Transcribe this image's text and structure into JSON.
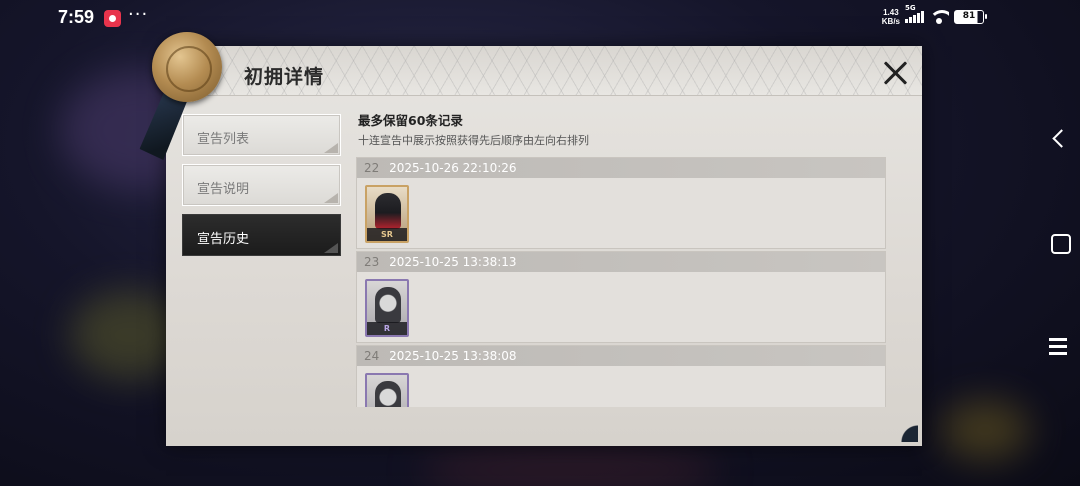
{
  "status_bar": {
    "time": "7:59",
    "dots": "···",
    "net_speed_value": "1.43",
    "net_speed_unit": "KB/s",
    "network": "5G",
    "battery": "81"
  },
  "dialog": {
    "title": "初拥详情",
    "tabs": [
      {
        "label": "宣告列表"
      },
      {
        "label": "宣告说明"
      },
      {
        "label": "宣告历史",
        "active": true
      }
    ],
    "content_title": "最多保留60条记录",
    "content_subtitle": "十连宣告中展示按照获得先后顺序由左向右排列",
    "records": [
      {
        "num": "22",
        "datetime": "2025-10-26 22:10:26",
        "rarity": "SR"
      },
      {
        "num": "23",
        "datetime": "2025-10-25 13:38:13",
        "rarity": "R"
      },
      {
        "num": "24",
        "datetime": "2025-10-25 13:38:08",
        "rarity": ""
      }
    ]
  },
  "icons": [
    "app-notification-icon",
    "wifi-icon",
    "signal-icon",
    "battery-icon",
    "close-icon",
    "seal-icon",
    "back-icon",
    "home-icon",
    "menu-icon"
  ]
}
